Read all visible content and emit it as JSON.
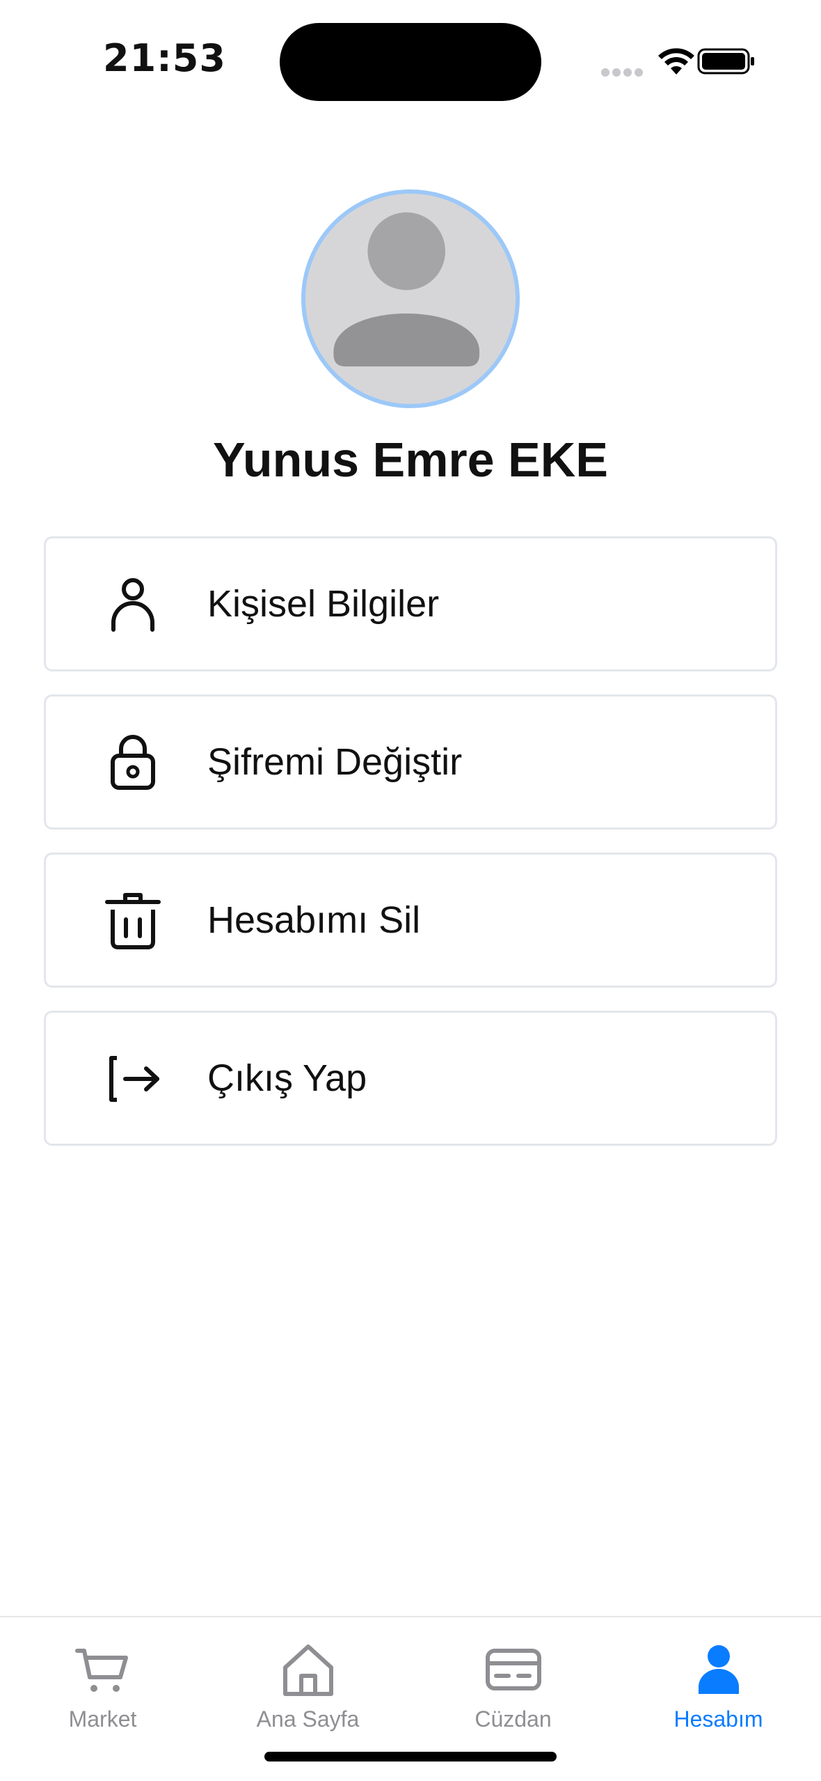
{
  "status_bar": {
    "time": "21:53",
    "icons": [
      "cellular-dots-icon",
      "wifi-icon",
      "battery-icon"
    ]
  },
  "profile": {
    "avatar_icon": "person-placeholder-icon",
    "name": "Yunus Emre EKE",
    "avatar_ring_color": "#9cc8f8"
  },
  "menu": {
    "items": [
      {
        "label": "Kişisel Bilgiler",
        "icon": "person-icon"
      },
      {
        "label": "Şifremi Değiştir",
        "icon": "lock-icon"
      },
      {
        "label": "Hesabımı Sil",
        "icon": "trash-icon"
      },
      {
        "label": "Çıkış Yap",
        "icon": "logout-icon"
      }
    ]
  },
  "tab_bar": {
    "tabs": [
      {
        "label": "Market",
        "icon": "cart-icon",
        "active": false
      },
      {
        "label": "Ana Sayfa",
        "icon": "home-icon",
        "active": false
      },
      {
        "label": "Cüzdan",
        "icon": "wallet-card-icon",
        "active": false
      },
      {
        "label": "Hesabım",
        "icon": "account-icon",
        "active": true
      }
    ],
    "active_color": "#0a7cff",
    "inactive_color": "#8e8e93"
  }
}
